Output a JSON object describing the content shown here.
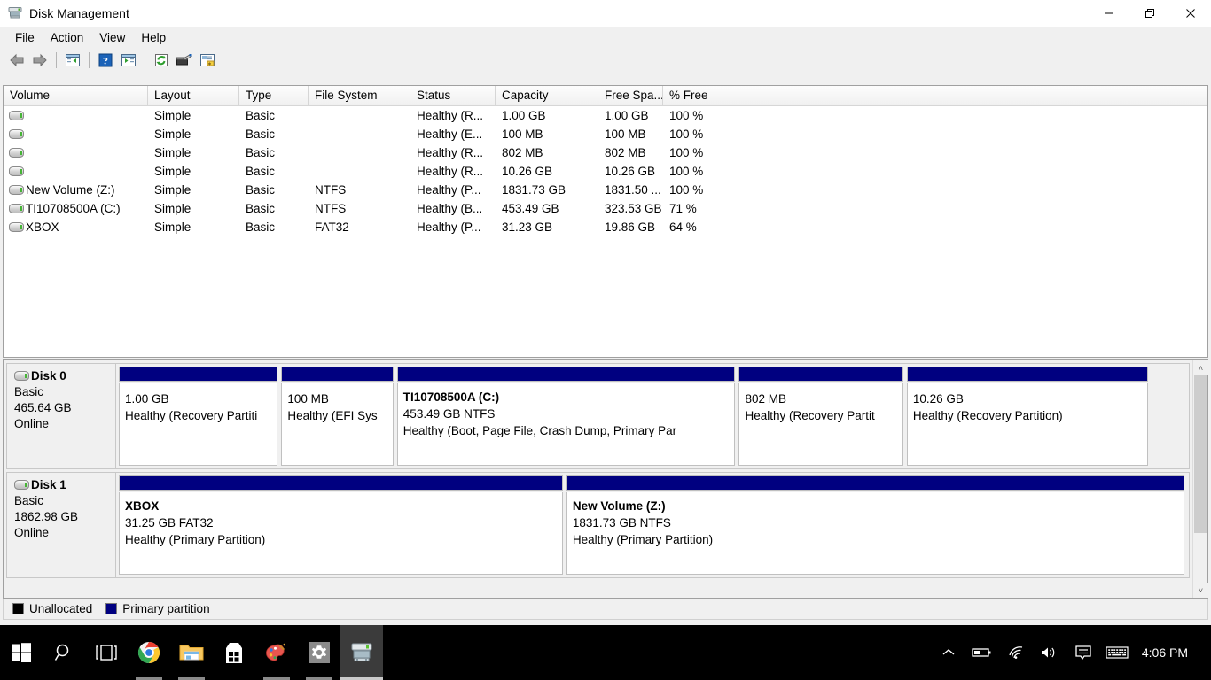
{
  "window": {
    "title": "Disk Management",
    "icon": "disk-management-icon",
    "buttons": {
      "minimize": "—",
      "maximize": "❐",
      "close": "✕"
    }
  },
  "menu": {
    "items": [
      "File",
      "Action",
      "View",
      "Help"
    ]
  },
  "toolbar": {
    "buttons": [
      {
        "name": "back-icon",
        "title": "Back"
      },
      {
        "name": "forward-icon",
        "title": "Forward"
      },
      {
        "name": "show-hide-console-tree-icon",
        "title": "Show/Hide Console Tree"
      },
      {
        "name": "help-icon",
        "title": "Help"
      },
      {
        "name": "show-hide-action-pane-icon",
        "title": "Show/Hide Action Pane"
      },
      {
        "name": "refresh-icon",
        "title": "Refresh"
      },
      {
        "name": "rescan-disks-icon",
        "title": "Rescan Disks"
      },
      {
        "name": "properties-icon",
        "title": "Properties"
      }
    ]
  },
  "volume_list": {
    "columns": [
      "Volume",
      "Layout",
      "Type",
      "File System",
      "Status",
      "Capacity",
      "Free Spa...",
      "% Free"
    ],
    "rows": [
      {
        "volume": "",
        "icon": "volume-icon",
        "layout": "Simple",
        "type": "Basic",
        "filesystem": "",
        "status": "Healthy (R...",
        "capacity": "1.00 GB",
        "free": "1.00 GB",
        "pctfree": "100 %"
      },
      {
        "volume": "",
        "icon": "volume-icon",
        "layout": "Simple",
        "type": "Basic",
        "filesystem": "",
        "status": "Healthy (E...",
        "capacity": "100 MB",
        "free": "100 MB",
        "pctfree": "100 %"
      },
      {
        "volume": "",
        "icon": "volume-icon",
        "layout": "Simple",
        "type": "Basic",
        "filesystem": "",
        "status": "Healthy (R...",
        "capacity": "802 MB",
        "free": "802 MB",
        "pctfree": "100 %"
      },
      {
        "volume": "",
        "icon": "volume-icon",
        "layout": "Simple",
        "type": "Basic",
        "filesystem": "",
        "status": "Healthy (R...",
        "capacity": "10.26 GB",
        "free": "10.26 GB",
        "pctfree": "100 %"
      },
      {
        "volume": "New Volume (Z:)",
        "icon": "volume-icon",
        "layout": "Simple",
        "type": "Basic",
        "filesystem": "NTFS",
        "status": "Healthy (P...",
        "capacity": "1831.73 GB",
        "free": "1831.50 ...",
        "pctfree": "100 %"
      },
      {
        "volume": "TI10708500A (C:)",
        "icon": "volume-icon",
        "layout": "Simple",
        "type": "Basic",
        "filesystem": "NTFS",
        "status": "Healthy (B...",
        "capacity": "453.49 GB",
        "free": "323.53 GB",
        "pctfree": "71 %"
      },
      {
        "volume": "XBOX",
        "icon": "volume-icon",
        "layout": "Simple",
        "type": "Basic",
        "filesystem": "FAT32",
        "status": "Healthy (P...",
        "capacity": "31.23 GB",
        "free": "19.86 GB",
        "pctfree": "64 %"
      }
    ]
  },
  "disk_map": {
    "disks": [
      {
        "name": "Disk 0",
        "icon": "disk-icon",
        "type": "Basic",
        "size": "465.64 GB",
        "state": "Online",
        "partitions": [
          {
            "name": "",
            "size": "1.00 GB",
            "fs": "",
            "status": "Healthy (Recovery Partiti",
            "width_pct": 14.9,
            "color": "#000080"
          },
          {
            "name": "",
            "size": "100 MB",
            "fs": "",
            "status": "Healthy (EFI Sys",
            "width_pct": 10.5,
            "color": "#000080"
          },
          {
            "name": "TI10708500A  (C:)",
            "size": "453.49 GB NTFS",
            "fs": "",
            "status": "Healthy (Boot, Page File, Crash Dump, Primary Par",
            "width_pct": 31.7,
            "color": "#000080"
          },
          {
            "name": "",
            "size": "802 MB",
            "fs": "",
            "status": "Healthy (Recovery Partit",
            "width_pct": 15.4,
            "color": "#000080"
          },
          {
            "name": "",
            "size": "10.26 GB",
            "fs": "",
            "status": "Healthy (Recovery Partition)",
            "width_pct": 22.6,
            "color": "#000080"
          }
        ]
      },
      {
        "name": "Disk 1",
        "icon": "disk-icon",
        "type": "Basic",
        "size": "1862.98 GB",
        "state": "Online",
        "partitions": [
          {
            "name": "XBOX",
            "size": "31.25 GB FAT32",
            "fs": "",
            "status": "Healthy (Primary Partition)",
            "width_pct": 41.6,
            "color": "#000080"
          },
          {
            "name": "New Volume  (Z:)",
            "size": "1831.73 GB NTFS",
            "fs": "",
            "status": "Healthy (Primary Partition)",
            "width_pct": 57.9,
            "color": "#000080"
          }
        ]
      }
    ],
    "scrollbar": {
      "up": "˄",
      "down": "˅"
    }
  },
  "legend": {
    "items": [
      {
        "label": "Unallocated",
        "color": "#000000"
      },
      {
        "label": "Primary partition",
        "color": "#000080"
      }
    ]
  },
  "taskbar": {
    "items": [
      {
        "name": "start-button",
        "label": "Start"
      },
      {
        "name": "search-icon",
        "label": "Search"
      },
      {
        "name": "task-view-icon",
        "label": "Task View"
      },
      {
        "name": "chrome-icon",
        "label": "Google Chrome"
      },
      {
        "name": "file-explorer-icon",
        "label": "File Explorer"
      },
      {
        "name": "microsoft-store-icon",
        "label": "Microsoft Store"
      },
      {
        "name": "paint-icon",
        "label": "Paint"
      },
      {
        "name": "settings-icon",
        "label": "Settings"
      },
      {
        "name": "disk-management-taskbar-icon",
        "label": "Disk Management"
      }
    ],
    "tray": [
      {
        "name": "show-hidden-icons-icon",
        "label": "Show hidden icons"
      },
      {
        "name": "battery-icon",
        "label": "Battery"
      },
      {
        "name": "wifi-icon",
        "label": "Network"
      },
      {
        "name": "volume-icon",
        "label": "Volume"
      },
      {
        "name": "action-center-icon",
        "label": "Notifications"
      },
      {
        "name": "touch-keyboard-icon",
        "label": "Touch keyboard"
      }
    ],
    "clock": "4:06 PM"
  }
}
